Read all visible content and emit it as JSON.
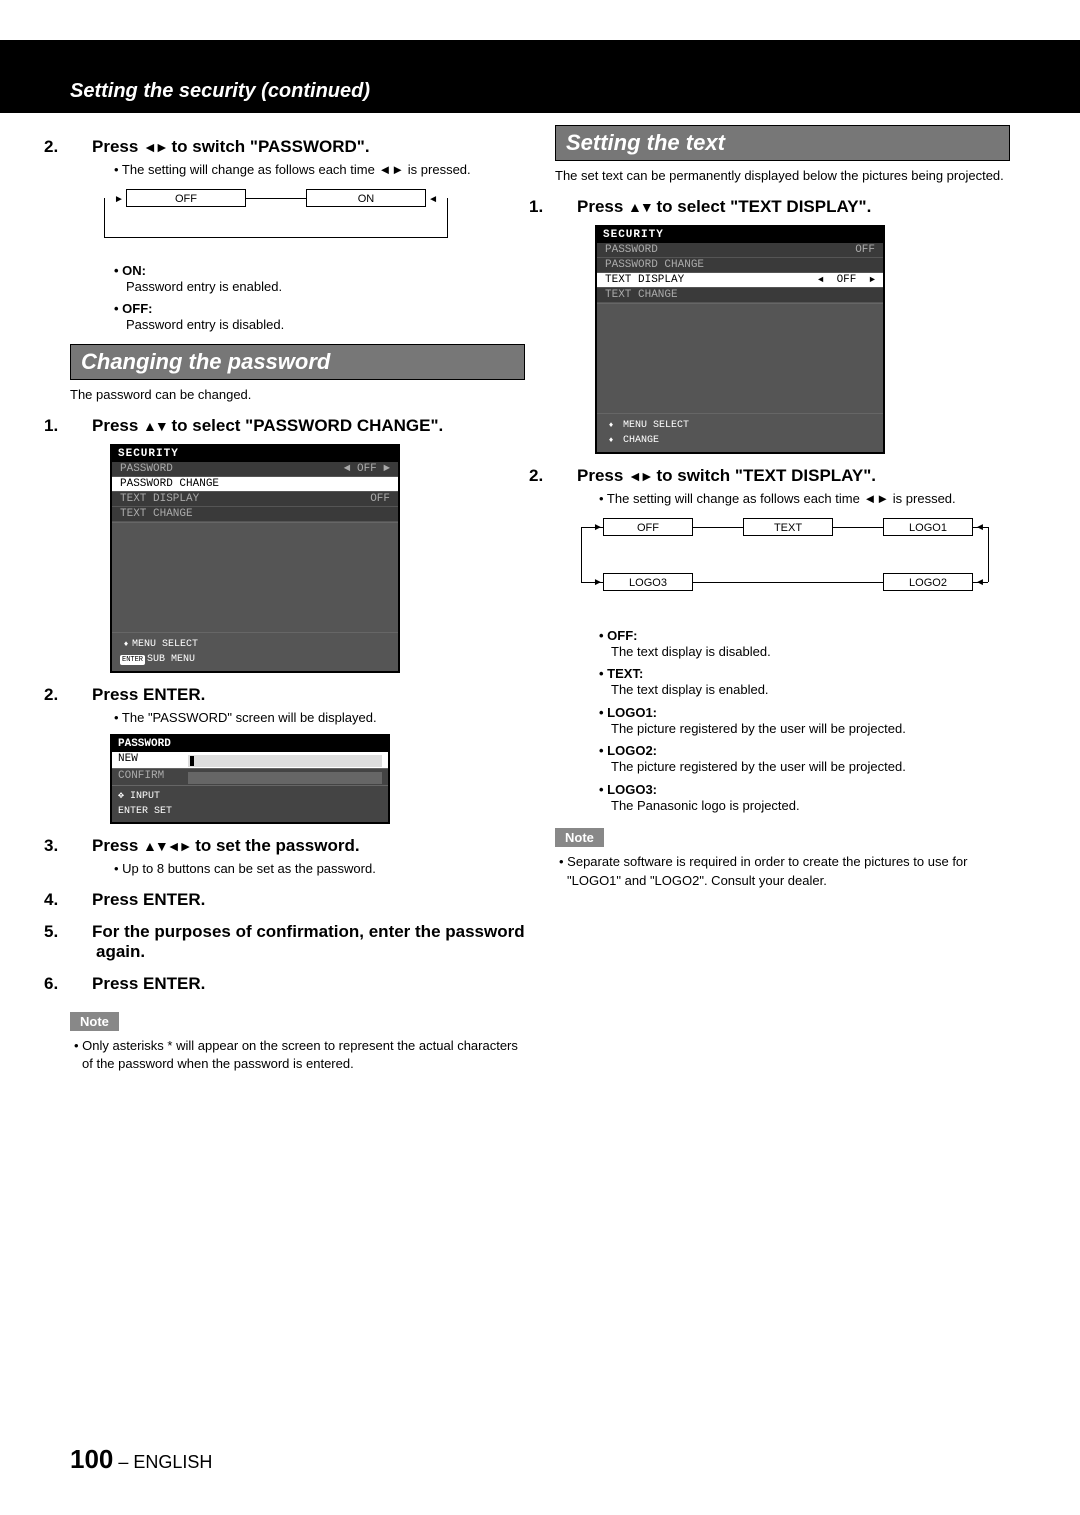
{
  "header": {
    "title": "Setting the security (continued)"
  },
  "left": {
    "step2": {
      "num": "2.",
      "text_a": "Press ",
      "text_b": " to switch \"PASSWORD\"."
    },
    "step2_bullet": "• The setting will change as follows each time ◄► is pressed.",
    "toggle2": {
      "off": "OFF",
      "on": "ON"
    },
    "on_label": "• ON:",
    "on_desc": "Password entry is enabled.",
    "off_label": "• OFF:",
    "off_desc": "Password entry is disabled.",
    "heading_change": "Changing the password",
    "intro_change": "The password can be changed.",
    "cp_step1": {
      "num": "1.",
      "text_a": "Press ",
      "text_b": " to select \"PASSWORD CHANGE\"."
    },
    "osd1": {
      "title": "SECURITY",
      "rows": [
        {
          "label": "PASSWORD",
          "val": "OFF",
          "dim": true,
          "arrows": true
        },
        {
          "label": "PASSWORD CHANGE",
          "val": "",
          "sel": true
        },
        {
          "label": "TEXT DISPLAY",
          "val": "OFF",
          "dim": true
        },
        {
          "label": "TEXT CHANGE",
          "val": "",
          "dim": true
        }
      ],
      "footer1": "MENU SELECT",
      "footer2_prefix": "ENTER",
      "footer2": "SUB MENU"
    },
    "cp_step2": {
      "num": "2.",
      "text": "Press ENTER."
    },
    "cp_step2_bullet": "• The \"PASSWORD\" screen will be displayed.",
    "osd2": {
      "title": "PASSWORD",
      "row_new": "NEW",
      "row_confirm": "CONFIRM",
      "footer1": "INPUT",
      "footer2_prefix": "ENTER",
      "footer2": "SET"
    },
    "cp_step3": {
      "num": "3.",
      "text_a": "Press ",
      "text_b": " to set the password."
    },
    "cp_step3_bullet": "• Up to 8 buttons can be set as the password.",
    "cp_step4": {
      "num": "4.",
      "text": "Press ENTER."
    },
    "cp_step5": {
      "num": "5.",
      "text": "For the purposes of confirmation, enter the password again."
    },
    "cp_step6": {
      "num": "6.",
      "text": "Press ENTER."
    },
    "note_label": "Note",
    "note_text": "• Only asterisks * will appear on the screen to represent the actual characters of the password when the password is entered."
  },
  "right": {
    "heading_text": "Setting the text",
    "intro_text": "The set text can be permanently displayed below the pictures being projected.",
    "st_step1": {
      "num": "1.",
      "text_a": "Press ",
      "text_b": " to select \"TEXT DISPLAY\"."
    },
    "osd3": {
      "title": "SECURITY",
      "rows": [
        {
          "label": "PASSWORD",
          "val": "OFF",
          "dim": true
        },
        {
          "label": "PASSWORD CHANGE",
          "val": "",
          "dim": true
        },
        {
          "label": "TEXT DISPLAY",
          "val": "OFF",
          "sel": true,
          "arrows": true
        },
        {
          "label": "TEXT CHANGE",
          "val": "",
          "dim": true
        }
      ],
      "footer1": "MENU SELECT",
      "footer2": "CHANGE"
    },
    "st_step2": {
      "num": "2.",
      "text_a": "Press ",
      "text_b": " to switch \"TEXT DISPLAY\"."
    },
    "st_step2_bullet": "• The setting will change as follows each time ◄► is pressed.",
    "toggle5": {
      "off": "OFF",
      "text": "TEXT",
      "logo1": "LOGO1",
      "logo2": "LOGO2",
      "logo3": "LOGO3"
    },
    "opts": [
      {
        "label": "• OFF:",
        "desc": "The text display is disabled."
      },
      {
        "label": "• TEXT:",
        "desc": "The text display is enabled."
      },
      {
        "label": "• LOGO1:",
        "desc": "The picture registered by the user will be projected."
      },
      {
        "label": "• LOGO2:",
        "desc": "The picture registered by the user will be projected."
      },
      {
        "label": "• LOGO3:",
        "desc": "The Panasonic logo is projected."
      }
    ],
    "note_label": "Note",
    "note_text": "• Separate software is required in order to create the pictures to use for \"LOGO1\" and \"LOGO2\". Consult your dealer."
  },
  "footer": {
    "page_num": "100",
    "lang": " – ENGLISH"
  }
}
